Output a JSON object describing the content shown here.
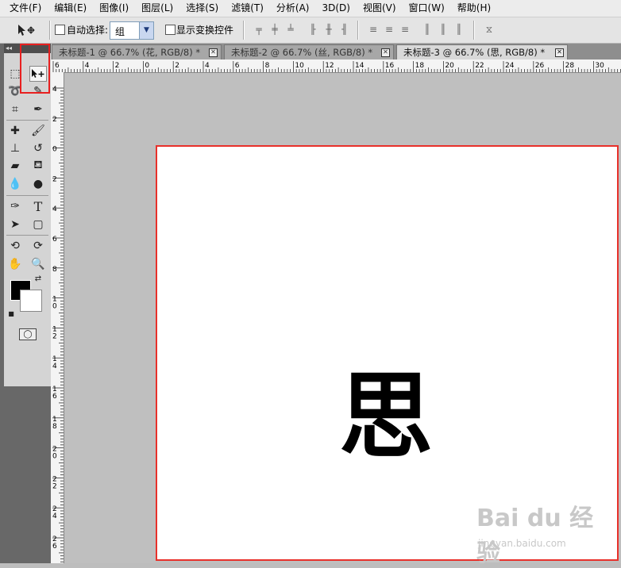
{
  "menu": [
    "文件(F)",
    "编辑(E)",
    "图像(I)",
    "图层(L)",
    "选择(S)",
    "滤镜(T)",
    "分析(A)",
    "3D(D)",
    "视图(V)",
    "窗口(W)",
    "帮助(H)"
  ],
  "options": {
    "tool_icon": "move-tool-icon",
    "auto_select_label": "自动选择:",
    "auto_select_checked": false,
    "auto_select_value": "组",
    "show_transform_label": "显示变换控件",
    "show_transform_checked": false
  },
  "tabs": [
    {
      "label": "未标题-1 @ 66.7% (花, RGB/8) *",
      "active": false
    },
    {
      "label": "未标题-2 @ 66.7% (丝, RGB/8) *",
      "active": false
    },
    {
      "label": "未标题-3 @ 66.7% (思, RGB/8) *",
      "active": true
    }
  ],
  "ruler_top_labels": [
    "6",
    "4",
    "2",
    "0",
    "2",
    "4",
    "6",
    "8",
    "10",
    "12",
    "14",
    "16",
    "18",
    "20",
    "22",
    "24",
    "26",
    "28",
    "30"
  ],
  "ruler_left_labels": [
    "4",
    "2",
    "0",
    "2",
    "4",
    "6",
    "8",
    "10",
    "12",
    "14",
    "16",
    "18",
    "20",
    "22",
    "24",
    "26"
  ],
  "document": {
    "character": "思"
  },
  "watermark": {
    "logo": "Bai du 经验",
    "url": "jingyan.baidu.com"
  },
  "colors": {
    "foreground": "#000000",
    "background": "#ffffff",
    "highlight": "#e8302a"
  }
}
